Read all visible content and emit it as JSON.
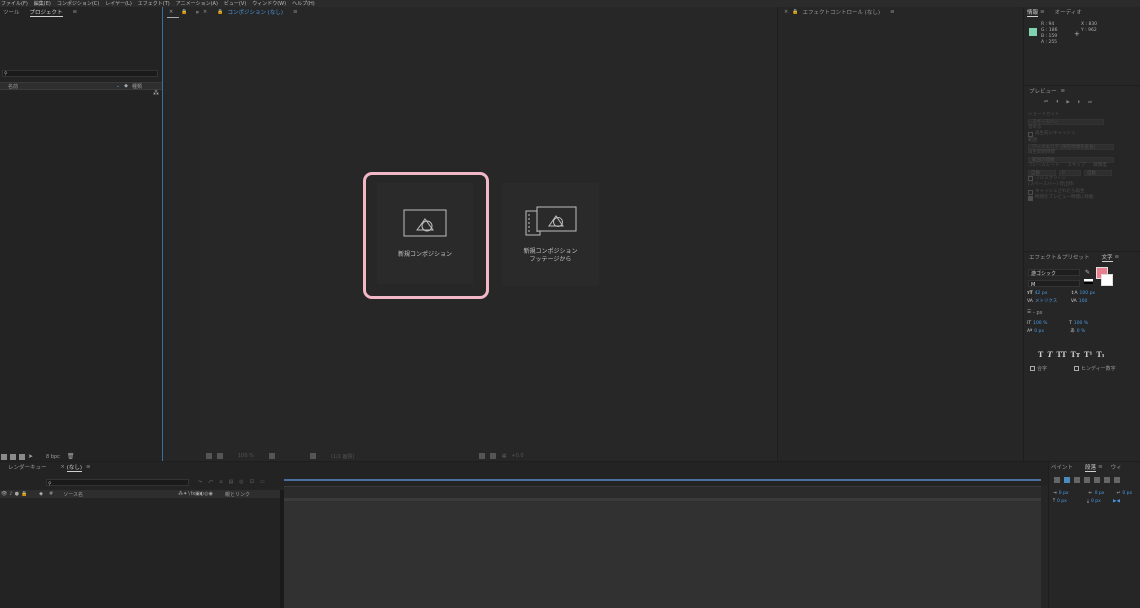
{
  "menu": [
    "ファイル(F)",
    "編集(E)",
    "コンポジション(C)",
    "レイヤー(L)",
    "エフェクト(T)",
    "アニメーション(A)",
    "ビュー(V)",
    "ウィンドウ(W)",
    "ヘルプ(H)"
  ],
  "project_panel": {
    "tabs": [
      "ツール",
      "プロジェクト"
    ],
    "search_placeholder": "",
    "col_name": "名前",
    "col_type": "種類",
    "bpc": "8 bpc"
  },
  "composition_panel": {
    "tab": "コンポジション (なし)",
    "zoom": "100 %",
    "quality": "(1/2 画質)",
    "new_comp_label": "新規コンポジション",
    "new_comp_from_footage_line1": "新規コンポジション",
    "new_comp_from_footage_line2": "フッテージから",
    "footer_value": "+0.0"
  },
  "effect_controls_panel": {
    "tab": "エフェクトコントロール (なし)"
  },
  "info_panel": {
    "tabs": [
      "情報",
      "オーディオ"
    ],
    "r": "R : 94",
    "g": "G : 186",
    "b": "B : 159",
    "a": "A : 255",
    "x": "X : 830",
    "y": "Y : 962",
    "swatch_color": "#7fd1b0"
  },
  "preview_panel": {
    "title": "プレビュー",
    "shortcut": "ショートカット",
    "spacebar": "スペースバー",
    "include": "含める",
    "cache_before": "再生前にキャッシュ",
    "range": "範囲",
    "range_value": "ワークエリア (現在時間を延長)",
    "play_from": "再生開始時間",
    "play_from_value": "範囲の開始",
    "frame_rate": "フレームレート",
    "skip": "スキップ",
    "resolution": "解像度",
    "auto": "自動",
    "auto2": "自動",
    "zero": "0",
    "fullscreen": "フルスクリーン",
    "stop_label": "(スペースバー) 停止時:",
    "cache_if": "キャッシュされたら再生",
    "move_time": "時間をプレビュー時間に移動"
  },
  "character_panel": {
    "tabs": [
      "エフェクト＆プリセット",
      "文字"
    ],
    "font": "游ゴシック",
    "style": "M",
    "size": "42 px",
    "leading": "100 px",
    "kerning": "メトリクス",
    "tracking": "100",
    "stroke_width": "- px",
    "vscale": "100 %",
    "hscale": "100 %",
    "baseline": "0 px",
    "tsume": "0 %",
    "format_buttons": [
      "T",
      "T",
      "TT",
      "Tт",
      "T¹",
      "T₁"
    ],
    "ligature": "合字",
    "hindi": "ヒンディー数字",
    "color_fill": "#e77f8f"
  },
  "timeline": {
    "tabs": [
      "レンダーキュー",
      "(なし)"
    ],
    "col_source": "ソース名",
    "col_parent": "親とリンク",
    "col_hash": "#"
  },
  "paragraph_panel": {
    "tabs": [
      "ペイント",
      "段落",
      "ウィ"
    ],
    "values": [
      "0 px",
      "0 px",
      "0 px",
      "0 px",
      "0 px"
    ]
  }
}
